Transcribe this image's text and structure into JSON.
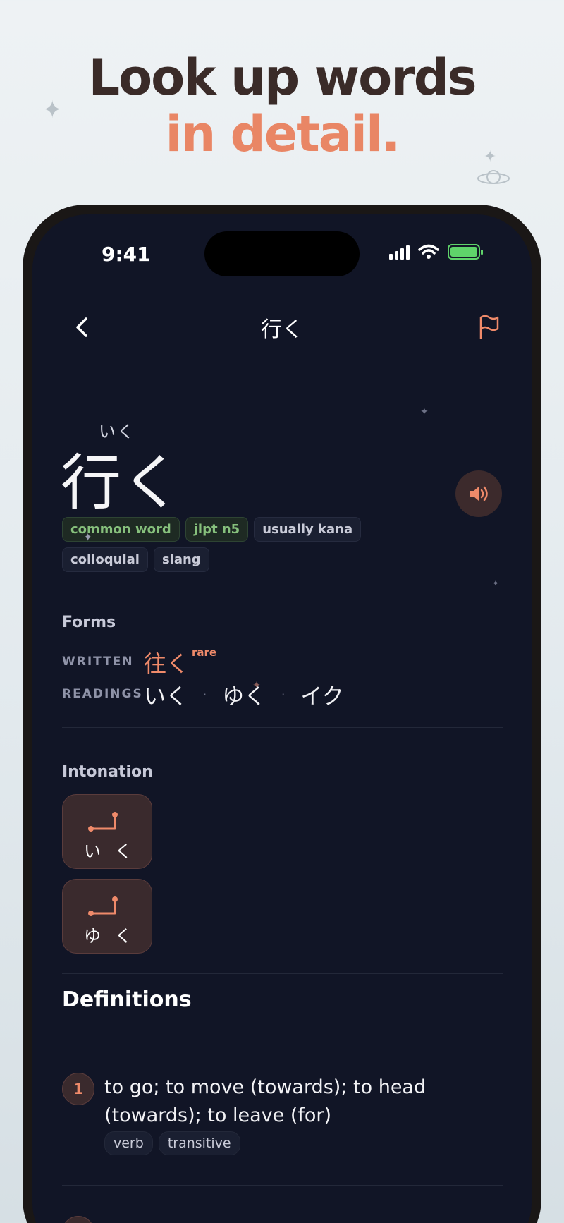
{
  "headline": {
    "line1": "Look up words",
    "line2": "in detail."
  },
  "status_bar": {
    "time": "9:41"
  },
  "nav": {
    "title": "行く",
    "back_icon": "chevron-left-icon",
    "report_icon": "flag-icon"
  },
  "entry": {
    "furigana": "いく",
    "word": "行く",
    "audio_icon": "speaker-icon",
    "tags": [
      {
        "label": "common word",
        "style": "green"
      },
      {
        "label": "jlpt n5",
        "style": "green"
      },
      {
        "label": "usually kana",
        "style": "gray"
      },
      {
        "label": "colloquial",
        "style": "gray"
      },
      {
        "label": "slang",
        "style": "gray"
      }
    ]
  },
  "forms": {
    "title": "Forms",
    "written_label": "WRITTEN",
    "written_value": "往く",
    "written_note": "rare",
    "readings_label": "READINGS",
    "readings": [
      "いく",
      "ゆく",
      "イク"
    ]
  },
  "intonation": {
    "title": "Intonation",
    "cards": [
      {
        "kana": [
          "い",
          "く"
        ]
      },
      {
        "kana": [
          "ゆ",
          "く"
        ]
      }
    ]
  },
  "definitions": {
    "title": "Definitions",
    "items": [
      {
        "number": "1",
        "text": "to go; to move (towards); to head (towards); to leave (for)",
        "tags": [
          "verb",
          "transitive"
        ]
      }
    ]
  },
  "colors": {
    "accent": "#ef8a6a",
    "background": "#111526",
    "green_tag": "#86c07c"
  }
}
